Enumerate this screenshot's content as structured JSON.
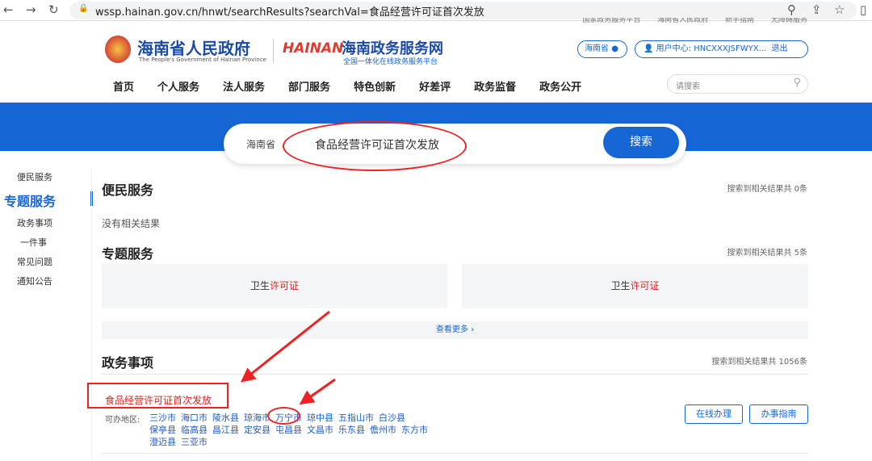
{
  "browser": {
    "url": "wssp.hainan.gov.cn/hnwt/searchResults?searchVal=食品经营许可证首次发放"
  },
  "toplinks": [
    "国家政务服务平台",
    "海南省人民政府",
    "新手指南",
    "无障碍服务"
  ],
  "header": {
    "gov_title": "海南省人民政府",
    "gov_subtitle": "The People's Government of Hainan Province",
    "logo_text": "HAINAN",
    "site_title": "海南政务服务网",
    "site_subtitle": "全国一体化在线政务服务平台",
    "region": "海南省",
    "user_center": "用户中心:  HNCXXXJSFWYX...",
    "logout": "退出",
    "search_placeholder": "请搜索"
  },
  "menu": [
    "首页",
    "个人服务",
    "法人服务",
    "部门服务",
    "特色创新",
    "好差评",
    "政务监督",
    "政务公开"
  ],
  "search": {
    "region": "海南省",
    "value": "食品经营许可证首次发放",
    "button": "搜索"
  },
  "sidebar": [
    "便民服务",
    "专题服务",
    "政务事项",
    "一件事",
    "常见问题",
    "通知公告"
  ],
  "sections": {
    "bianmin": {
      "title": "便民服务",
      "count": "搜索到相关结果共 0条",
      "empty": "没有相关结果"
    },
    "zhuanti": {
      "title": "专题服务",
      "count": "搜索到相关结果共 5条",
      "cards": [
        {
          "prefix": "卫生",
          "hl": "许可证"
        },
        {
          "prefix": "卫生",
          "hl": "许可证"
        }
      ],
      "more": "查看更多 ›"
    },
    "zhengwu": {
      "title": "政务事项",
      "count": "搜索到相关结果共 1056条",
      "item": {
        "title": "食品经营许可证首次发放",
        "area_label": "可办地区:",
        "areas": [
          "三沙市",
          "海口市",
          "陵水县",
          "琼海市",
          "万宁市",
          "琼中县",
          "五指山市",
          "白沙县",
          "保亭县",
          "临高县",
          "昌江县",
          "定安县",
          "屯昌县",
          "文昌市",
          "乐东县",
          "儋州市",
          "东方市",
          "澄迈县",
          "三亚市"
        ],
        "online": "在线办理",
        "guide": "办事指南"
      }
    }
  }
}
